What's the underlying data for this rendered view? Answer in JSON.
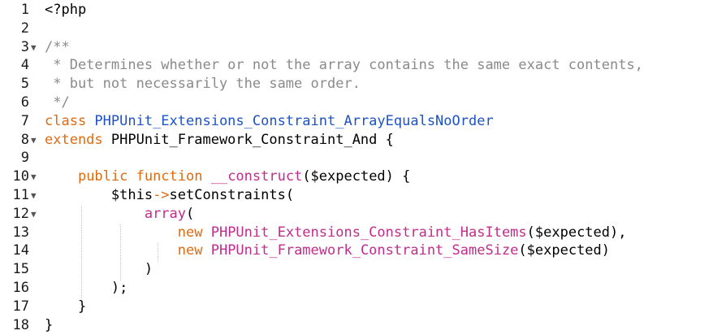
{
  "lines": [
    {
      "num": "1",
      "fold": "",
      "tokens": [
        {
          "t": "<?php",
          "c": ""
        }
      ]
    },
    {
      "num": "2",
      "fold": "",
      "tokens": []
    },
    {
      "num": "3",
      "fold": "▼",
      "tokens": [
        {
          "t": "/**",
          "c": "cmt"
        }
      ]
    },
    {
      "num": "4",
      "fold": "",
      "tokens": [
        {
          "t": " * Determines whether or not the array contains the same exact contents,",
          "c": "cmt"
        }
      ]
    },
    {
      "num": "5",
      "fold": "",
      "tokens": [
        {
          "t": " * but not necessarily the same order.",
          "c": "cmt"
        }
      ]
    },
    {
      "num": "6",
      "fold": "",
      "tokens": [
        {
          "t": " */",
          "c": "cmt"
        }
      ]
    },
    {
      "num": "7",
      "fold": "",
      "tokens": [
        {
          "t": "class ",
          "c": "kw"
        },
        {
          "t": "PHPUnit_Extensions_Constraint_ArrayEqualsNoOrder",
          "c": "cls"
        }
      ]
    },
    {
      "num": "8",
      "fold": "▼",
      "tokens": [
        {
          "t": "extends ",
          "c": "kw"
        },
        {
          "t": "PHPUnit_Framework_Constraint_And {",
          "c": ""
        }
      ]
    },
    {
      "num": "9",
      "fold": "",
      "tokens": []
    },
    {
      "num": "10",
      "fold": "▼",
      "tokens": [
        {
          "t": "    ",
          "c": ""
        },
        {
          "t": "public function ",
          "c": "kw"
        },
        {
          "t": "__construct",
          "c": "fn"
        },
        {
          "t": "($expected) {",
          "c": ""
        }
      ]
    },
    {
      "num": "11",
      "fold": "▼",
      "tokens": [
        {
          "t": "        $this",
          "c": ""
        },
        {
          "t": "->",
          "c": "arrow"
        },
        {
          "t": "setConstraints(",
          "c": ""
        }
      ]
    },
    {
      "num": "12",
      "fold": "▼",
      "tokens": [
        {
          "t": "            ",
          "c": ""
        },
        {
          "t": "array",
          "c": "fn"
        },
        {
          "t": "(",
          "c": ""
        }
      ]
    },
    {
      "num": "13",
      "fold": "",
      "tokens": [
        {
          "t": "                ",
          "c": ""
        },
        {
          "t": "new ",
          "c": "kw"
        },
        {
          "t": "PHPUnit_Extensions_Constraint_HasItems",
          "c": "fn"
        },
        {
          "t": "($expected),",
          "c": ""
        }
      ]
    },
    {
      "num": "14",
      "fold": "",
      "tokens": [
        {
          "t": "                ",
          "c": ""
        },
        {
          "t": "new ",
          "c": "kw"
        },
        {
          "t": "PHPUnit_Framework_Constraint_SameSize",
          "c": "fn"
        },
        {
          "t": "($expected)",
          "c": ""
        }
      ]
    },
    {
      "num": "15",
      "fold": "",
      "tokens": [
        {
          "t": "            )",
          "c": ""
        }
      ]
    },
    {
      "num": "16",
      "fold": "",
      "tokens": [
        {
          "t": "        );",
          "c": ""
        }
      ]
    },
    {
      "num": "17",
      "fold": "",
      "tokens": [
        {
          "t": "    }",
          "c": ""
        }
      ]
    },
    {
      "num": "18",
      "fold": "",
      "tokens": [
        {
          "t": "}",
          "c": ""
        }
      ]
    }
  ]
}
